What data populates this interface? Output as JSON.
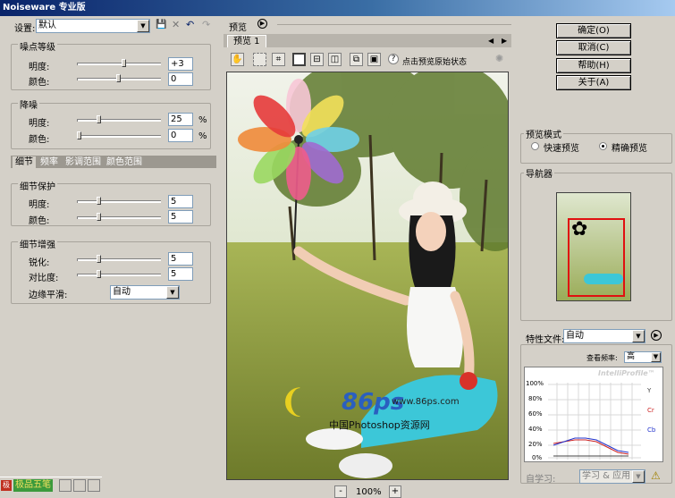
{
  "window": {
    "title": "Noiseware 专业版"
  },
  "settings": {
    "label": "设置:",
    "value": "默认"
  },
  "noise_level": {
    "title": "噪点等级",
    "rows": [
      {
        "label": "明度:",
        "value": "+3"
      },
      {
        "label": "颜色:",
        "value": "0"
      }
    ]
  },
  "noise_reduction": {
    "title": "降噪",
    "rows": [
      {
        "label": "明度:",
        "value": "25",
        "unit": "%"
      },
      {
        "label": "颜色:",
        "value": "0",
        "unit": "%"
      }
    ]
  },
  "tabs": [
    "细节",
    "频率",
    "影调范围",
    "颜色范围"
  ],
  "detail_protect": {
    "title": "细节保护",
    "rows": [
      {
        "label": "明度:",
        "value": "5"
      },
      {
        "label": "颜色:",
        "value": "5"
      }
    ]
  },
  "detail_enhance": {
    "title": "细节增强",
    "rows": [
      {
        "label": "锐化:",
        "value": "5"
      },
      {
        "label": "对比度:",
        "value": "5"
      }
    ],
    "smooth_label": "边缘平滑:",
    "smooth_value": "自动"
  },
  "preview": {
    "label": "预览",
    "tab": "预览 1",
    "hint": "点击预览原始状态",
    "zoom": "100%",
    "minus": "-",
    "plus": "+"
  },
  "buttons": {
    "ok": "确定(O)",
    "cancel": "取消(C)",
    "help": "帮助(H)",
    "about": "关于(A)"
  },
  "preview_mode": {
    "title": "预览模式",
    "fast": "快速预览",
    "accurate": "精确预览"
  },
  "navigator": {
    "title": "导航器"
  },
  "profile": {
    "label": "特性文件:",
    "value": "自动",
    "view_label": "查看频率:",
    "view_value": "高",
    "brand": "IntelliProfile™",
    "y_ticks": [
      "100%",
      "80%",
      "60%",
      "40%",
      "20%",
      "0%"
    ],
    "legend": [
      "Y",
      "Cr",
      "Cb"
    ],
    "learn_label": "自学习:",
    "learn_value": "学习 & 应用"
  },
  "taskbar": {
    "ime": "极品五笔"
  },
  "watermark": {
    "logo": "86ps",
    "url": "www.86ps.com",
    "text": "中国Photoshop资源网"
  },
  "colors": {
    "title_start": "#0a246a",
    "chart_y": "#444444",
    "chart_cr": "#cc2222",
    "chart_cb": "#2233cc"
  }
}
